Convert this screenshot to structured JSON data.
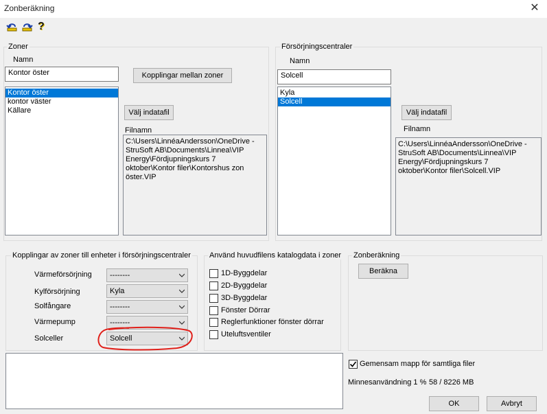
{
  "window": {
    "title": "Zonberäkning",
    "close": "✕"
  },
  "toolbar": {
    "undo": "undo-icon",
    "redo": "redo-icon",
    "help": "?"
  },
  "zones": {
    "group_label": "Zoner",
    "name_label": "Namn",
    "name_value": "Kontor öster",
    "connections_button": "Kopplingar mellan zoner",
    "items": [
      "Kontor öster",
      "kontor väster",
      "Källare"
    ],
    "selected_index": 0,
    "choose_file_button": "Välj indatafil",
    "filename_label": "Filnamn",
    "filename_value": "C:\\Users\\LinnéaAndersson\\OneDrive - StruSoft AB\\Documents\\Linnea\\VIP Energy\\Fördjupningskurs 7 oktober\\Kontor filer\\Kontorshus zon öster.VIP"
  },
  "supply": {
    "group_label": "Försörjningscentraler",
    "name_label": "Namn",
    "name_value": "Solcell",
    "items": [
      "Kyla",
      "Solcell"
    ],
    "selected_index": 1,
    "choose_file_button": "Välj indatafil",
    "filename_label": "Filnamn",
    "filename_value": "C:\\Users\\LinnéaAndersson\\OneDrive - StruSoft AB\\Documents\\Linnea\\VIP Energy\\Fördjupningskurs 7 oktober\\Kontor filer\\Solcell.VIP"
  },
  "links": {
    "group_label": "Kopplingar av zoner till enheter i försörjningscentraler",
    "rows": [
      {
        "label": "Värmeförsörjning",
        "value": "--------"
      },
      {
        "label": "Kylförsörjning",
        "value": "Kyla"
      },
      {
        "label": "Solfångare",
        "value": "--------"
      },
      {
        "label": "Värmepump",
        "value": "--------"
      },
      {
        "label": "Solceller",
        "value": "Solcell"
      }
    ],
    "highlight_color": "#e0201a"
  },
  "catalog": {
    "group_label": "Använd huvudfilens katalogdata i zoner",
    "items": [
      "1D-Byggdelar",
      "2D-Byggdelar",
      "3D-Byggdelar",
      "Fönster Dörrar",
      "Reglerfunktioner fönster dörrar",
      "Uteluftsventiler"
    ]
  },
  "calc": {
    "group_label": "Zonberäkning",
    "button": "Beräkna"
  },
  "footer": {
    "shared_folder_label": "Gemensam mapp för samtliga filer",
    "shared_folder_checked": true,
    "memory_label": "Minnesanvändning 1 %",
    "memory_value": "58 / 8226 MB",
    "ok": "OK",
    "cancel": "Avbryt"
  },
  "colors": {
    "selection": "#0078d7",
    "dialog_bg": "#f0f0f0"
  }
}
